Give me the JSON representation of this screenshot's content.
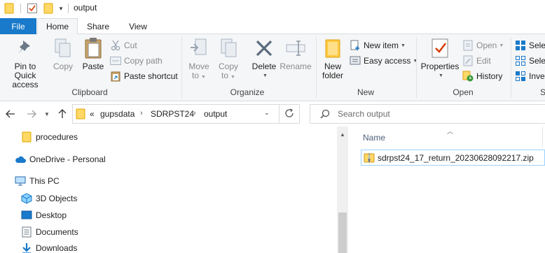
{
  "window": {
    "title": "output"
  },
  "tabs": {
    "file": "File",
    "home": "Home",
    "share": "Share",
    "view": "View"
  },
  "ribbon": {
    "clipboard": {
      "label": "Clipboard",
      "pin_line1": "Pin to Quick",
      "pin_line2": "access",
      "copy": "Copy",
      "paste": "Paste",
      "cut": "Cut",
      "copy_path": "Copy path",
      "paste_shortcut": "Paste shortcut"
    },
    "organize": {
      "label": "Organize",
      "move_line1": "Move",
      "move_line2": "to",
      "copyto_line1": "Copy",
      "copyto_line2": "to",
      "delete": "Delete",
      "rename": "Rename"
    },
    "new": {
      "label": "New",
      "folder_line1": "New",
      "folder_line2": "folder",
      "new_item": "New item",
      "easy_access": "Easy access"
    },
    "open": {
      "label": "Open",
      "properties": "Properties",
      "open": "Open",
      "edit": "Edit",
      "history": "History"
    },
    "select": {
      "label": "S",
      "select_all": "Selec",
      "select_none": "Selec",
      "invert": "Inver"
    }
  },
  "address": {
    "overflow": "«",
    "crumbs": [
      "gupsdata",
      "SDRPST24",
      "output"
    ],
    "search_placeholder": "Search output"
  },
  "navigation": {
    "items": [
      {
        "label": "procedures",
        "icon": "folder-icon"
      },
      {
        "label": "OneDrive - Personal",
        "icon": "onedrive-cloud-icon"
      },
      {
        "label": "This PC",
        "icon": "computer-icon"
      },
      {
        "label": "3D Objects",
        "icon": "3d-objects-icon"
      },
      {
        "label": "Desktop",
        "icon": "desktop-icon"
      },
      {
        "label": "Documents",
        "icon": "documents-icon"
      },
      {
        "label": "Downloads",
        "icon": "downloads-icon"
      }
    ]
  },
  "content": {
    "column_name": "Name",
    "files": [
      {
        "name": "sdrpst24_17_return_20230628092217.zip",
        "icon": "zip-archive-icon"
      }
    ]
  },
  "colors": {
    "file_tab": "#1979ca",
    "ribbon_bg": "#f5f6f7",
    "folder_yellow": "#ffc83d",
    "selection_border": "#99d1ff"
  }
}
